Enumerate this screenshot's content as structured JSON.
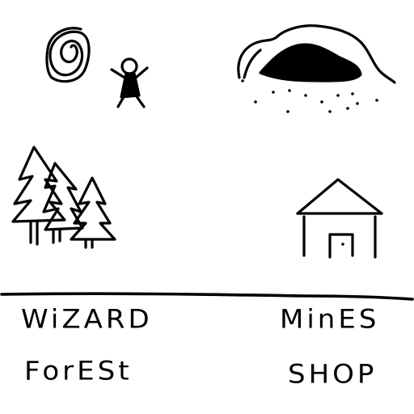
{
  "menu": {
    "options": [
      {
        "id": "wizard",
        "label": "WiZARD"
      },
      {
        "id": "mines",
        "label": "MinES"
      },
      {
        "id": "forest",
        "label": "ForESt"
      },
      {
        "id": "shop",
        "label": "SHOP"
      }
    ]
  },
  "icons": {
    "portal": "spiral-portal-icon",
    "character": "stick-figure-icon",
    "cave": "cave-icon",
    "trees": "pine-trees-icon",
    "house": "house-icon"
  },
  "colors": {
    "ink": "#000000",
    "background": "#ffffff"
  }
}
